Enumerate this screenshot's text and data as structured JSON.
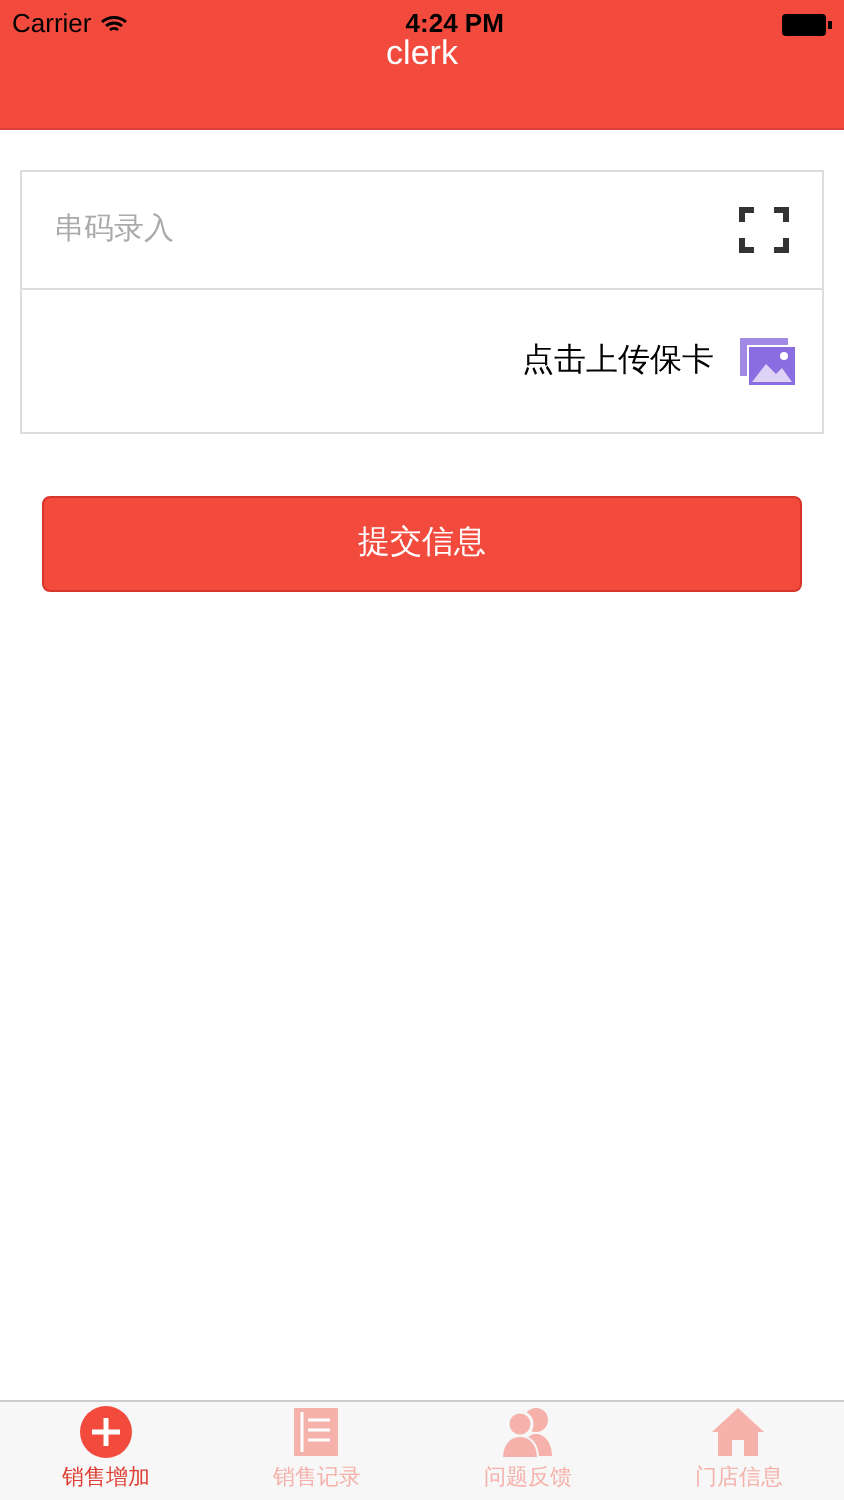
{
  "status_bar": {
    "carrier": "Carrier",
    "time": "4:24 PM"
  },
  "nav": {
    "title": "clerk"
  },
  "form": {
    "serial": {
      "placeholder": "串码录入"
    },
    "upload": {
      "label": "点击上传保卡"
    }
  },
  "submit": "提交信息",
  "tabs": [
    {
      "kind": "add",
      "label": "销售增加",
      "selected": true
    },
    {
      "kind": "records",
      "label": "销售记录",
      "selected": false
    },
    {
      "kind": "feedback",
      "label": "问题反馈",
      "selected": false
    },
    {
      "kind": "store",
      "label": "门店信息",
      "selected": false
    }
  ]
}
